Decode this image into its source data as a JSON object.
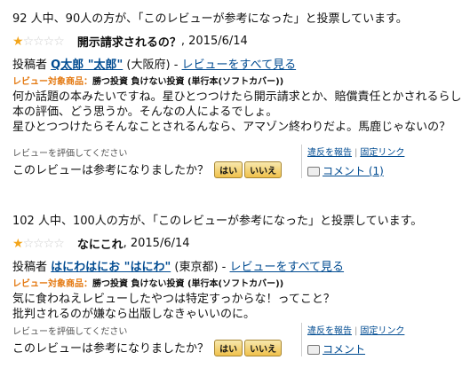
{
  "reviews": [
    {
      "helpful_text": "92 人中、90人の方が、「このレビューが参考になった」と投票しています。",
      "stars_on": "★",
      "stars_off": "☆☆☆☆",
      "title": "開示請求されるの？",
      "date": ", 2015/6/14",
      "author_label": "投稿者",
      "author_name": "Q太郎 \"太郎\"",
      "author_location": "(大阪府) - ",
      "all_reviews_link": "レビューをすべて見る",
      "product_label": "レビュー対象商品：",
      "product_name": "勝つ投資 負けない投資 (単行本(ソフトカバー))",
      "body_lines": [
        "何か話題の本みたいですね。星ひとつつけたら開示請求とか、賠償責任とかされるらしい。",
        "本の評価、どう思うか。そんなの人によるでしょ。",
        "星ひとつつけたらそんなことされるんなら、アマゾン終わりだよ。馬鹿じゃないの？"
      ],
      "eval_label": "レビューを評価してください",
      "eval_question": "このレビューは参考になりましたか？",
      "yes_label": "はい",
      "no_label": "いいえ",
      "report_link": "違反を報告",
      "permalink": "固定リンク",
      "comment_link": "コメント (1)"
    },
    {
      "helpful_text": "102 人中、100人の方が、「このレビューが参考になった」と投票しています。",
      "stars_on": "★",
      "stars_off": "☆☆☆☆",
      "title": "なにこれ",
      "date": ", 2015/6/14",
      "author_label": "投稿者",
      "author_name": "はにわはにお \"はにわ\"",
      "author_location": "(東京都) - ",
      "all_reviews_link": "レビューをすべて見る",
      "product_label": "レビュー対象商品：",
      "product_name": "勝つ投資 負けない投資 (単行本(ソフトカバー))",
      "body_lines": [
        "気に食わねえレビューしたやつは特定すっからな！ってこと？",
        "批判されるのが嫌なら出版しなきゃいいのに。"
      ],
      "eval_label": "レビューを評価してください",
      "eval_question": "このレビューは参考になりましたか？",
      "yes_label": "はい",
      "no_label": "いいえ",
      "report_link": "違反を報告",
      "permalink": "固定リンク",
      "comment_link": "コメント"
    }
  ],
  "colors": {
    "link": "#004b91",
    "product_label": "#e47911",
    "star": "#f3a51b"
  },
  "rating": {
    "value": 1,
    "max": 5
  }
}
